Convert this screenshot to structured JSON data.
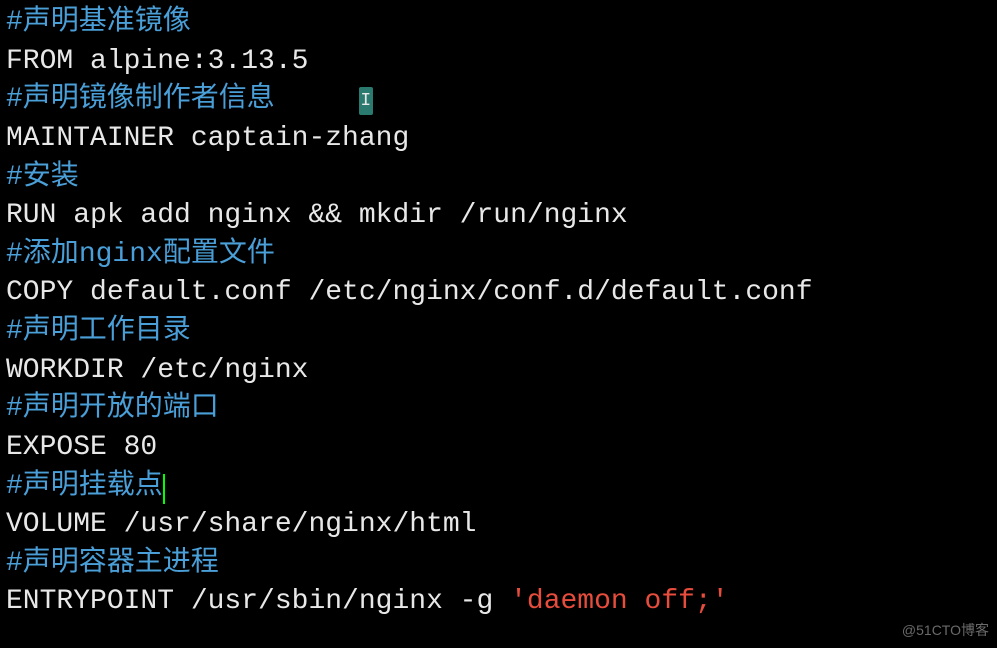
{
  "dockerfile": {
    "lines": [
      {
        "type": "comment",
        "text": "#声明基准镜像"
      },
      {
        "type": "code",
        "text": "FROM alpine:3.13.5"
      },
      {
        "type": "comment-with-cursor",
        "text": "#声明镜像制作者信息",
        "cursor_char": "I"
      },
      {
        "type": "code",
        "text": "MAINTAINER captain-zhang"
      },
      {
        "type": "comment",
        "text": "#安装"
      },
      {
        "type": "code",
        "text": "RUN apk add nginx && mkdir /run/nginx"
      },
      {
        "type": "comment-mixed",
        "prefix": "#添加",
        "highlight": "nginx",
        "suffix": "配置文件"
      },
      {
        "type": "code",
        "text": "COPY default.conf /etc/nginx/conf.d/default.conf"
      },
      {
        "type": "comment",
        "text": "#声明工作目录"
      },
      {
        "type": "code",
        "text": "WORKDIR /etc/nginx"
      },
      {
        "type": "comment",
        "text": "#声明开放的端口"
      },
      {
        "type": "code",
        "text": "EXPOSE 80"
      },
      {
        "type": "comment-edit",
        "text": "#声明挂载点"
      },
      {
        "type": "code",
        "text": "VOLUME /usr/share/nginx/html"
      },
      {
        "type": "comment",
        "text": "#声明容器主进程"
      },
      {
        "type": "code-with-string",
        "prefix": "ENTRYPOINT /usr/sbin/nginx -g ",
        "string": "'daemon off;'"
      }
    ]
  },
  "watermark": "@51CTO博客"
}
